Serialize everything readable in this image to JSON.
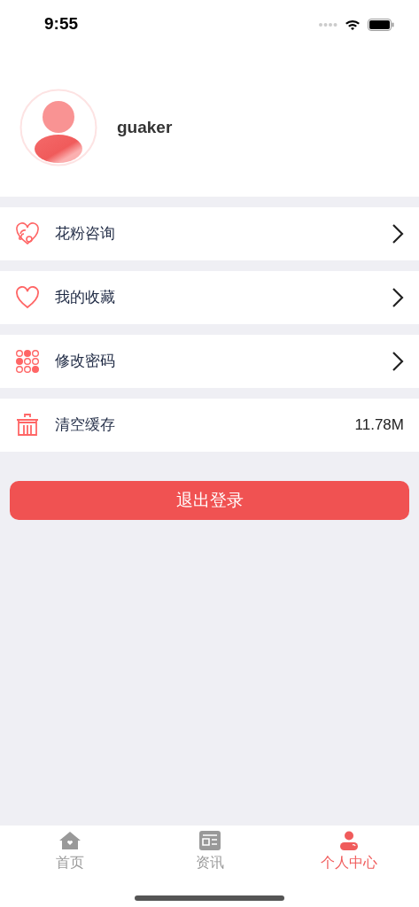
{
  "status_bar": {
    "time": "9:55"
  },
  "profile": {
    "username": "guaker"
  },
  "menu": [
    {
      "kind": "consult",
      "label": "花粉咨询",
      "arrow": true
    },
    {
      "kind": "favorite",
      "label": "我的收藏",
      "arrow": true
    },
    {
      "kind": "password",
      "label": "修改密码",
      "arrow": true
    },
    {
      "kind": "cache",
      "label": "清空缓存",
      "arrow": false,
      "value": "11.78M"
    }
  ],
  "logout_button": "退出登录",
  "tabs": [
    {
      "kind": "home",
      "label": "首页",
      "selected": false
    },
    {
      "kind": "news",
      "label": "资讯",
      "selected": false
    },
    {
      "kind": "profile",
      "label": "个人中心",
      "selected": true
    }
  ]
}
